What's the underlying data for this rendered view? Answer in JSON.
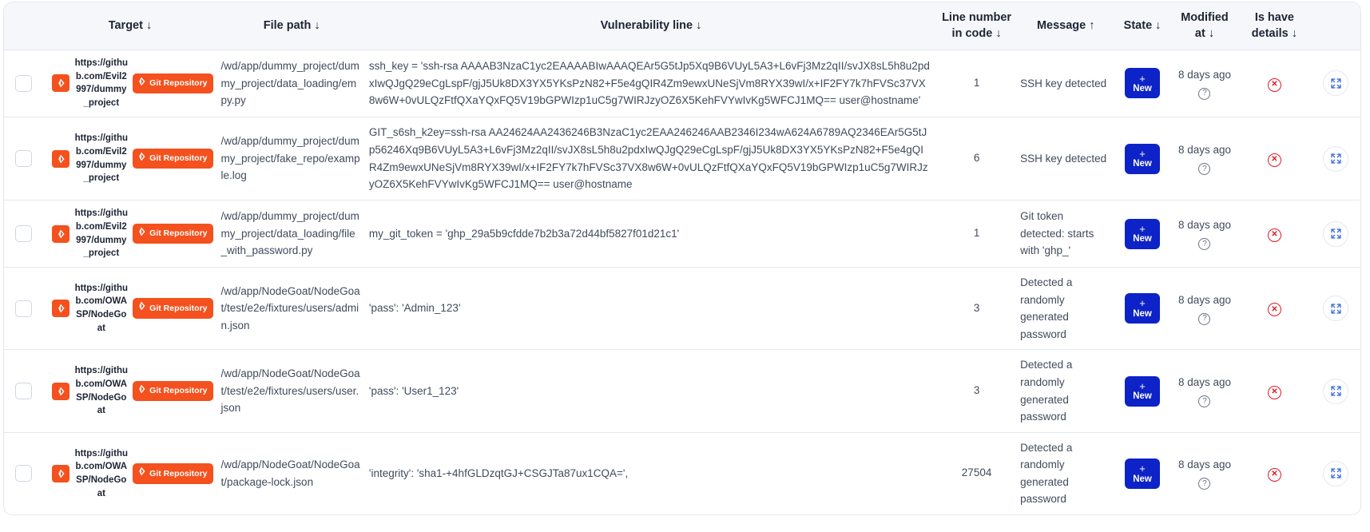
{
  "table": {
    "columns": [
      {
        "key": "checkbox",
        "label": "",
        "sort": ""
      },
      {
        "key": "target",
        "label": "Target",
        "sort": "↓"
      },
      {
        "key": "file_path",
        "label": "File path",
        "sort": "↓"
      },
      {
        "key": "vulnerability_line",
        "label": "Vulnerability line",
        "sort": "↓"
      },
      {
        "key": "line_number",
        "label": "Line number in code",
        "sort": "↓"
      },
      {
        "key": "message",
        "label": "Message",
        "sort": "↑"
      },
      {
        "key": "state",
        "label": "State",
        "sort": "↓"
      },
      {
        "key": "modified_at",
        "label": "Modified at",
        "sort": "↓"
      },
      {
        "key": "is_have_details",
        "label": "Is have details",
        "sort": "↓"
      },
      {
        "key": "expand",
        "label": "",
        "sort": ""
      }
    ],
    "badge_label": "Git Repository",
    "state_plus": "+",
    "state_label": "New",
    "help_glyph": "?",
    "details_glyph": "✕",
    "rows": [
      {
        "target_url": "https://github.com/Evil2997/dummy_project",
        "file_path": "/wd/app/dummy_project/dummy_project/data_loading/empy.py",
        "vulnerability_line": "ssh_key = 'ssh-rsa AAAAB3NzaC1yc2EAAAABIwAAAQEAr5G5tJp5Xq9B6VUyL5A3+L6vFj3Mz2qII/svJX8sL5h8u2pdxIwQJgQ29eCgLspF/gjJ5Uk8DX3YX5YKsPzN82+F5e4gQIR4Zm9ewxUNeSjVm8RYX39wI/x+IF2FY7k7hFVSc37VX8w6W+0vULQzFtfQXaYQxFQ5V19bGPWIzp1uC5g7WIRJzyOZ6X5KehFVYwIvKg5WFCJ1MQ== user@hostname'",
        "line_number": "1",
        "message": "SSH key detected",
        "state": "New",
        "modified_at": "8 days ago"
      },
      {
        "target_url": "https://github.com/Evil2997/dummy_project",
        "file_path": "/wd/app/dummy_project/dummy_project/fake_repo/example.log",
        "vulnerability_line": "GIT_s6sh_k2ey=ssh-rsa AA24624AA2436246B3NzaC1yc2EAA246246AAB2346I234wA624A6789AQ2346EAr5G5tJp56246Xq9B6VUyL5A3+L6vFj3Mz2qII/svJX8sL5h8u2pdxIwQJgQ29eCgLspF/gjJ5Uk8DX3YX5YKsPzN82+F5e4gQIR4Zm9ewxUNeSjVm8RYX39wI/x+IF2FY7k7hFVSc37VX8w6W+0vULQzFtfQXaYQxFQ5V19bGPWIzp1uC5g7WIRJzyOZ6X5KehFVYwIvKg5WFCJ1MQ== user@hostname",
        "line_number": "6",
        "message": "SSH key detected",
        "state": "New",
        "modified_at": "8 days ago"
      },
      {
        "target_url": "https://github.com/Evil2997/dummy_project",
        "file_path": "/wd/app/dummy_project/dummy_project/data_loading/file_with_password.py",
        "vulnerability_line": "my_git_token = 'ghp_29a5b9cfdde7b2b3a72d44bf5827f01d21c1'",
        "line_number": "1",
        "message": "Git token detected: starts with 'ghp_'",
        "state": "New",
        "modified_at": "8 days ago"
      },
      {
        "target_url": "https://github.com/OWASP/NodeGoat",
        "file_path": "/wd/app/NodeGoat/NodeGoat/test/e2e/fixtures/users/admin.json",
        "vulnerability_line": "'pass': 'Admin_123'",
        "line_number": "3",
        "message": "Detected a randomly generated password",
        "state": "New",
        "modified_at": "8 days ago"
      },
      {
        "target_url": "https://github.com/OWASP/NodeGoat",
        "file_path": "/wd/app/NodeGoat/NodeGoat/test/e2e/fixtures/users/user.json",
        "vulnerability_line": "'pass': 'User1_123'",
        "line_number": "3",
        "message": "Detected a randomly generated password",
        "state": "New",
        "modified_at": "8 days ago"
      },
      {
        "target_url": "https://github.com/OWASP/NodeGoat",
        "file_path": "/wd/app/NodeGoat/NodeGoat/package-lock.json",
        "vulnerability_line": "'integrity': 'sha1-+4hfGLDzqtGJ+CSGJTa87ux1CQA=',",
        "line_number": "27504",
        "message": "Detected a randomly generated password",
        "state": "New",
        "modified_at": "8 days ago"
      }
    ]
  },
  "colors": {
    "brand_orange": "#f4511e",
    "state_blue": "#0d23c8",
    "danger_red": "#e01b24",
    "header_bg": "#f5f7fb",
    "border": "#e3e8ef"
  }
}
